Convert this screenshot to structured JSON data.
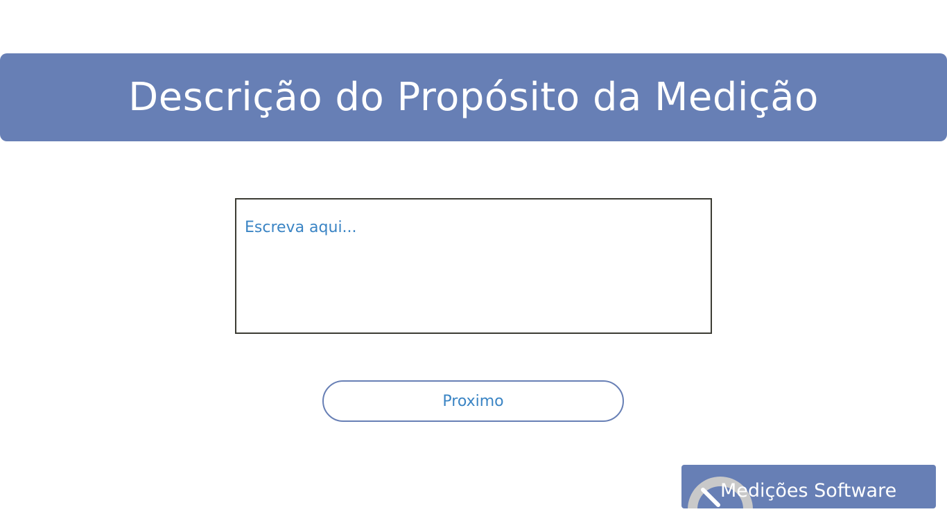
{
  "header": {
    "title": "Descrição do Propósito da Medição"
  },
  "description": {
    "value": "",
    "placeholder": "Escreva aqui..."
  },
  "actions": {
    "next_label": "Proximo"
  },
  "brand": {
    "label": "Medições Software",
    "icon": "gauge-icon"
  },
  "colors": {
    "accent": "#677fb5",
    "link_text": "#3a84c4",
    "border_dark": "#3b3b33",
    "gauge_ring": "#c9c9c9"
  }
}
